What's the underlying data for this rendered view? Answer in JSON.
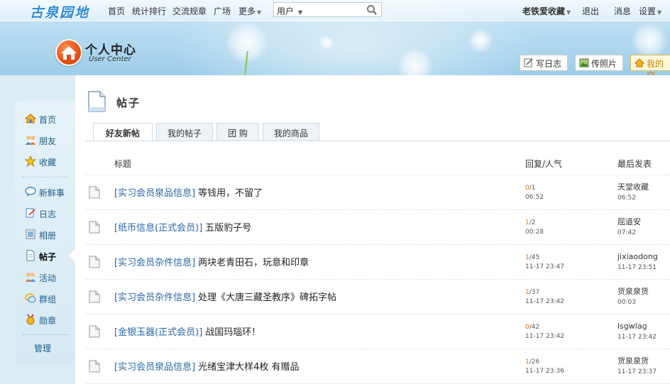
{
  "site": {
    "logo_text": "古泉园地"
  },
  "topnav": {
    "links": [
      "首页",
      "统计排行",
      "交流规章",
      "广场",
      "更多"
    ],
    "search": {
      "type_label": "用户",
      "placeholder": ""
    },
    "user": {
      "name": "老铁爱收藏",
      "logout": "退出",
      "messages": "消息",
      "settings": "设置"
    }
  },
  "user_center": {
    "title": "个人中心",
    "subtitle": "User Center",
    "quick_actions": [
      "写日志",
      "传照片",
      "我的空"
    ]
  },
  "sidebar": {
    "items": [
      {
        "label": "首页",
        "icon": "home-icon"
      },
      {
        "label": "朋友",
        "icon": "friends-icon"
      },
      {
        "label": "收藏",
        "icon": "star-icon"
      },
      {
        "label": "新鲜事",
        "icon": "bubble-icon"
      },
      {
        "label": "日志",
        "icon": "journal-icon"
      },
      {
        "label": "相册",
        "icon": "album-icon"
      },
      {
        "label": "帖子",
        "icon": "post-icon",
        "active": true
      },
      {
        "label": "活动",
        "icon": "activity-icon"
      },
      {
        "label": "群组",
        "icon": "group-icon"
      },
      {
        "label": "勋章",
        "icon": "medal-icon"
      }
    ],
    "manage": "管理"
  },
  "main": {
    "title": "帖子",
    "tabs": [
      {
        "label": "好友新帖",
        "active": true
      },
      {
        "label": "我的帖子"
      },
      {
        "label": "团 购"
      },
      {
        "label": "我的商品"
      }
    ],
    "columns": {
      "title": "标题",
      "stats": "回复/人气",
      "last": "最后发表"
    },
    "rows": [
      {
        "category": "[实习会员泉品信息]",
        "title": "等钱用，不留了",
        "replies": "0",
        "views": "/1",
        "time": "06:52",
        "last_user": "天堂收藏",
        "last_time": "06:52"
      },
      {
        "category": "[纸币信息(正式会员)]",
        "title": "五版豹子号",
        "replies": "1",
        "views": "/2",
        "time": "00:28",
        "last_user": "屈道安",
        "last_time": "07:42"
      },
      {
        "category": "[实习会员杂件信息]",
        "title": "两块老青田石，玩意和印章",
        "replies": "1",
        "views": "/45",
        "time": "11-17 23:47",
        "last_user": "jixiaodong",
        "last_time": "11-17 23:51"
      },
      {
        "category": "[实习会员杂件信息]",
        "title": "处理《大唐三藏圣教序》碑拓字帖",
        "replies": "1",
        "views": "/37",
        "time": "11-17 23:42",
        "last_user": "货泉泉货",
        "last_time": "00:03"
      },
      {
        "category": "[金银玉器(正式会员)]",
        "title": "战国玛瑙环！",
        "replies": "0",
        "views": "/42",
        "time": "11-17 23:42",
        "last_user": "lsgwlag",
        "last_time": "11-17 23:42"
      },
      {
        "category": "[实习会员泉品信息]",
        "title": "光绪宝津大样4枚  有赠品",
        "replies": "1",
        "views": "/26",
        "time": "11-17 23:36",
        "last_user": "货泉泉货",
        "last_time": "11-17 23:37"
      }
    ]
  }
}
